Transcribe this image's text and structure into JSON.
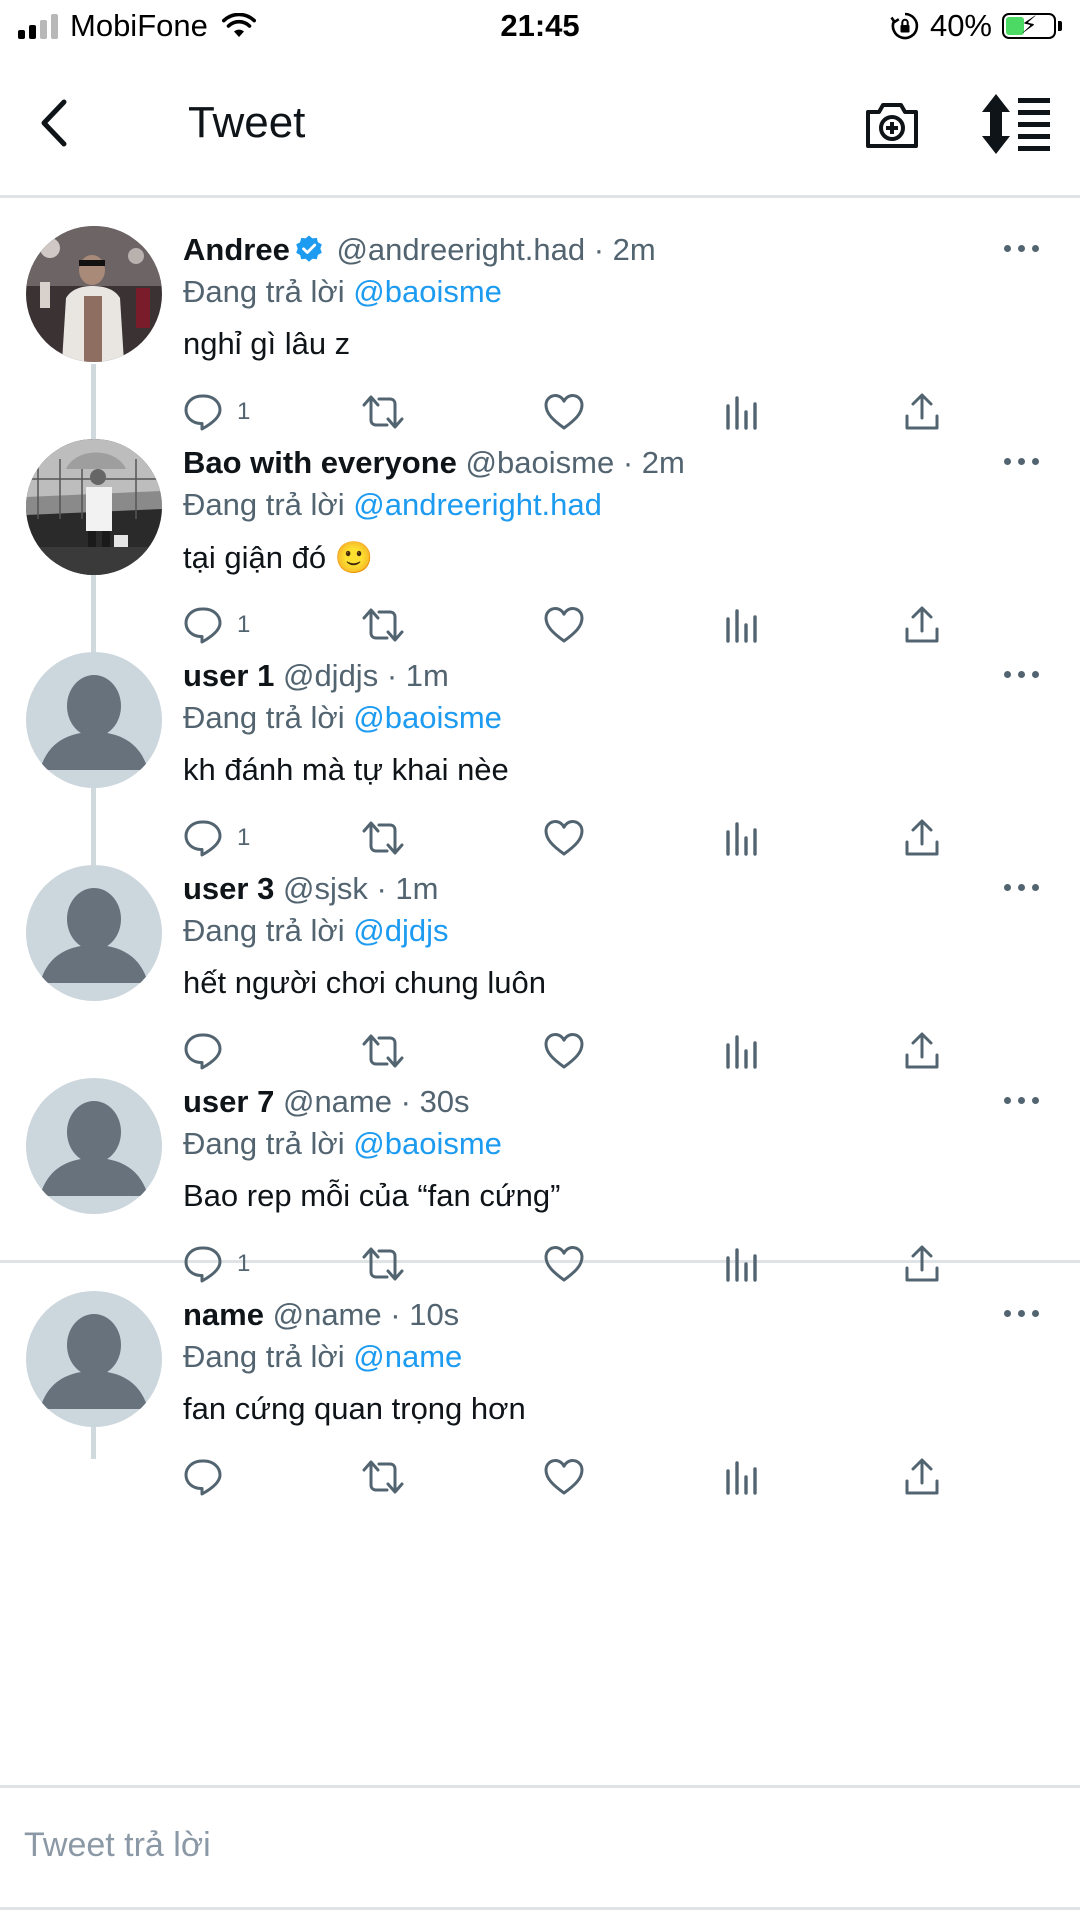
{
  "status_bar": {
    "carrier": "MobiFone",
    "time": "21:45",
    "battery_percent": "40%",
    "battery_level": 0.4,
    "signal_bars_on": 2,
    "icons": [
      "signal-icon",
      "wifi-icon",
      "orientation-lock-icon",
      "battery-charging-icon"
    ]
  },
  "header": {
    "title": "Tweet",
    "icons": [
      "back-chevron-icon",
      "camera-plus-icon",
      "sort-icon"
    ]
  },
  "colors": {
    "link_blue": "#1d9bf0",
    "secondary_text": "#536471",
    "divider": "#dfe3e6",
    "thread_line": "#cfd9de",
    "battery_green": "#4cd964"
  },
  "tweets": [
    {
      "name": "Andree",
      "verified": true,
      "handle": "@andreeright.had",
      "separator": "·",
      "time": "2m",
      "replying_prefix": "Đang trả lời",
      "replying_to": "@baoisme",
      "text": "nghỉ gì lâu z",
      "reply_count": "1",
      "avatar": "photo-performer"
    },
    {
      "name": "Bao with everyone",
      "verified": false,
      "handle": "@baoisme",
      "separator": "·",
      "time": "2m",
      "replying_prefix": "Đang trả lời",
      "replying_to": "@andreeright.had",
      "text": "tại giận đó 🙂",
      "reply_count": "1",
      "avatar": "photo-bw-umbrella"
    },
    {
      "name": "user 1",
      "verified": false,
      "handle": "@djdjs",
      "separator": "·",
      "time": "1m",
      "replying_prefix": "Đang trả lời",
      "replying_to": "@baoisme",
      "text": "kh đánh mà tự khai nèe",
      "reply_count": "1",
      "avatar": "default-avatar"
    },
    {
      "name": "user 3",
      "verified": false,
      "handle": "@sjsk",
      "separator": "·",
      "time": "1m",
      "replying_prefix": "Đang trả lời",
      "replying_to": "@djdjs",
      "text": "hết người chơi chung luôn",
      "reply_count": "",
      "avatar": "default-avatar"
    },
    {
      "name": "user 7",
      "verified": false,
      "handle": "@name",
      "separator": "·",
      "time": "30s",
      "replying_prefix": "Đang trả lời",
      "replying_to": "@baoisme",
      "text": "Bao rep mỗi của “fan cứng”",
      "reply_count": "1",
      "avatar": "default-avatar"
    },
    {
      "name": "name",
      "verified": false,
      "handle": "@name",
      "separator": "·",
      "time": "10s",
      "replying_prefix": "Đang trả lời",
      "replying_to": "@name",
      "text": "fan cứng quan trọng hơn",
      "reply_count": "",
      "avatar": "default-avatar"
    }
  ],
  "action_icons": [
    "reply-icon",
    "retweet-icon",
    "like-icon",
    "analytics-icon",
    "share-icon"
  ],
  "reply_box": {
    "placeholder": "Tweet trả lời"
  }
}
